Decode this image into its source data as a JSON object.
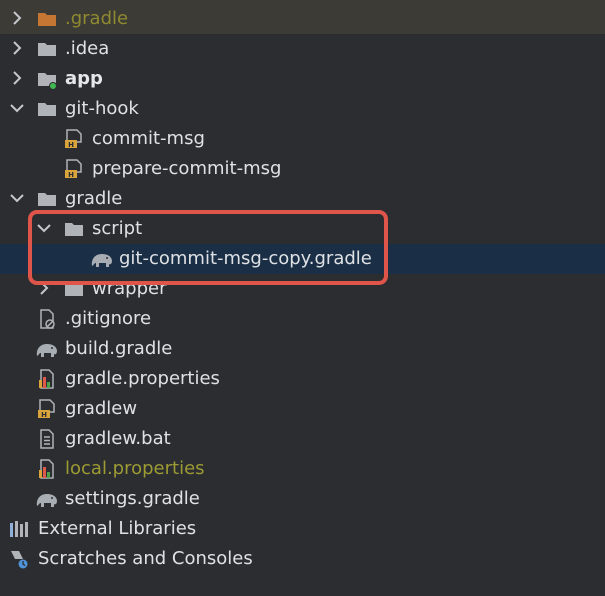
{
  "tree": {
    "items": [
      {
        "label": ".gradle",
        "icon": "folder-orange-icon",
        "expanded": false
      },
      {
        "label": ".idea",
        "icon": "folder-icon",
        "expanded": false
      },
      {
        "label": "app",
        "icon": "module-folder-icon",
        "expanded": false
      },
      {
        "label": "git-hook",
        "icon": "folder-icon",
        "expanded": true
      },
      {
        "label": "commit-msg",
        "icon": "shell-script-icon"
      },
      {
        "label": "prepare-commit-msg",
        "icon": "shell-script-icon"
      },
      {
        "label": "gradle",
        "icon": "folder-icon",
        "expanded": true
      },
      {
        "label": "script",
        "icon": "folder-icon",
        "expanded": true
      },
      {
        "label": "git-commit-msg-copy.gradle",
        "icon": "gradle-elephant-icon",
        "selected": true
      },
      {
        "label": "wrapper",
        "icon": "folder-icon",
        "expanded": false
      },
      {
        "label": ".gitignore",
        "icon": "gitignore-file-icon"
      },
      {
        "label": "build.gradle",
        "icon": "gradle-elephant-icon"
      },
      {
        "label": "gradle.properties",
        "icon": "properties-file-icon"
      },
      {
        "label": "gradlew",
        "icon": "shell-script-icon"
      },
      {
        "label": "gradlew.bat",
        "icon": "text-file-icon"
      },
      {
        "label": "local.properties",
        "icon": "properties-file-icon"
      },
      {
        "label": "settings.gradle",
        "icon": "gradle-elephant-icon"
      },
      {
        "label": "External Libraries",
        "icon": "libraries-icon",
        "expanded": false
      },
      {
        "label": "Scratches and Consoles",
        "icon": "scratches-icon"
      }
    ]
  },
  "colors": {
    "background": "#2b2d30",
    "selection": "#1a2f45",
    "excluded_row": "#3d3b36",
    "highlight_border": "#e0554a",
    "folder": "#b0b3b8",
    "folder_orange": "#c57633"
  }
}
